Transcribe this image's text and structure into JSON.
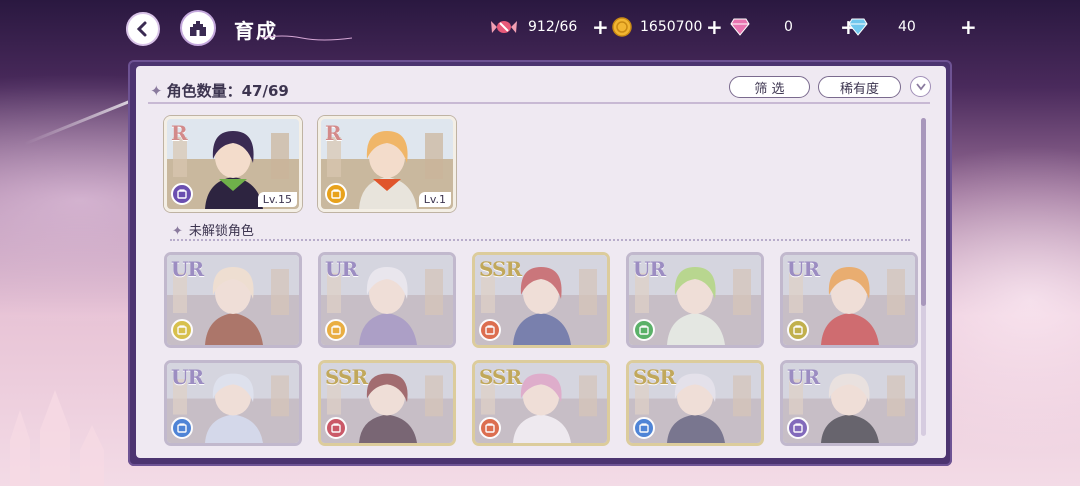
{
  "header": {
    "title": "育成",
    "title_script": "Ylenm"
  },
  "resources": [
    {
      "icon": "candy-icon",
      "value": "912/66",
      "color": "#e85a7a"
    },
    {
      "icon": "gold-coin-icon",
      "value": "1650700",
      "color": "#f2b632"
    },
    {
      "icon": "pink-diamond-icon",
      "value": "0",
      "color": "#e874b0"
    },
    {
      "icon": "blue-diamond-icon",
      "value": "40",
      "color": "#6fc7ee"
    }
  ],
  "panel": {
    "count_label": "角色数量：",
    "count_value": "47/69",
    "filter_label": "筛 选",
    "sort_label": "稀有度",
    "locked_section_label": "未解锁角色"
  },
  "owned_characters": [
    {
      "rarity": "R",
      "level": "Lv.15",
      "attr_color": "#6b4fb0",
      "hair": "#3a2a52",
      "cloth": "#2d2440",
      "accent": "#6fb04a"
    },
    {
      "rarity": "R",
      "level": "Lv.1",
      "attr_color": "#e8a21c",
      "hair": "#f0b668",
      "cloth": "#e8e4dc",
      "accent": "#e0552b"
    }
  ],
  "locked_characters": [
    {
      "rarity": "UR",
      "attr_color": "#d2b82a",
      "hair": "#f0dcc0",
      "cloth": "#8a3a20",
      "frame": "#b8aec6"
    },
    {
      "rarity": "UR",
      "attr_color": "#e8a21c",
      "hair": "#e8e8ee",
      "cloth": "#8a7ab0",
      "frame": "#b8aec6"
    },
    {
      "rarity": "SSR",
      "attr_color": "#d9542c",
      "hair": "#b83a3a",
      "cloth": "#3a4a8a",
      "frame": "#d8c68a"
    },
    {
      "rarity": "UR",
      "attr_color": "#3aa54a",
      "hair": "#9ccf5a",
      "cloth": "#e0eadc",
      "frame": "#b8aec6"
    },
    {
      "rarity": "UR",
      "attr_color": "#b8a42a",
      "hair": "#e8902a",
      "cloth": "#c02a2a",
      "frame": "#b8aec6"
    },
    {
      "rarity": "UR",
      "attr_color": "#2d6fd0",
      "hair": "#d8e0ee",
      "cloth": "#c8d2e8",
      "frame": "#b8aec6"
    },
    {
      "rarity": "SSR",
      "attr_color": "#c23a4a",
      "hair": "#7a2a2a",
      "cloth": "#3a2030",
      "frame": "#d8c68a"
    },
    {
      "rarity": "SSR",
      "attr_color": "#d9542c",
      "hair": "#d890b8",
      "cloth": "#f0eef0",
      "frame": "#d8c68a"
    },
    {
      "rarity": "SSR",
      "attr_color": "#2d6fd0",
      "hair": "#e0e0e8",
      "cloth": "#3a3a5a",
      "frame": "#d8c68a"
    },
    {
      "rarity": "UR",
      "attr_color": "#6b4fb0",
      "hair": "#e8e0d8",
      "cloth": "#1e1e26",
      "frame": "#b8aec6"
    }
  ]
}
